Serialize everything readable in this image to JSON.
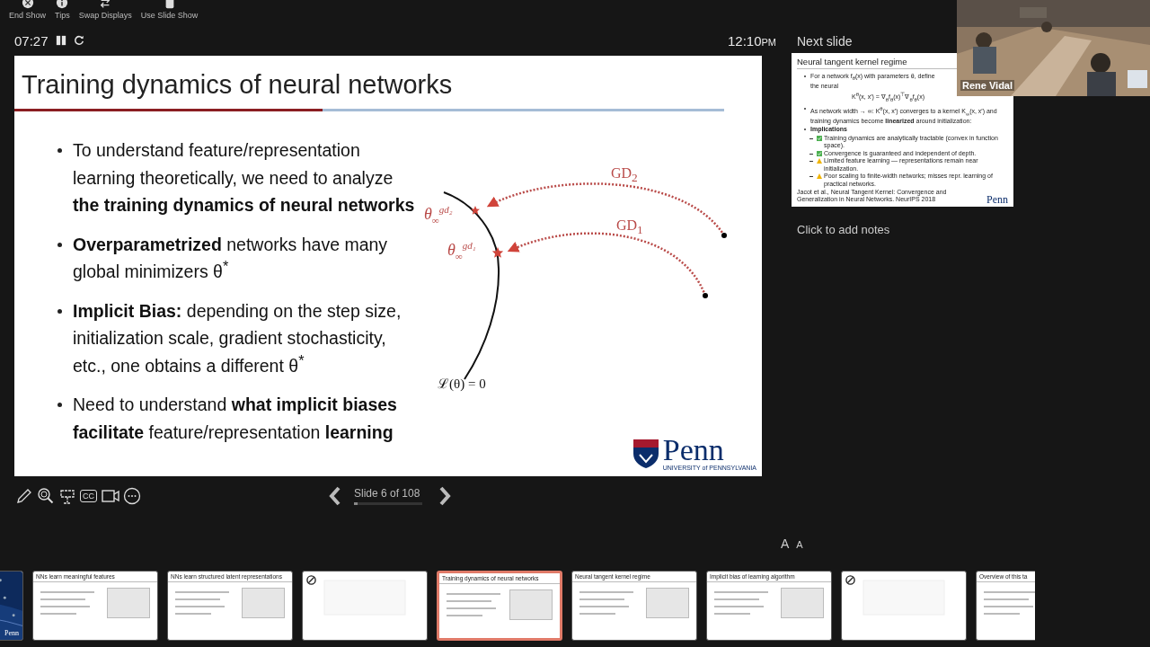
{
  "top_toolbar": [
    {
      "kind": "end",
      "label": "End Show"
    },
    {
      "kind": "tips",
      "label": "Tips"
    },
    {
      "kind": "swap",
      "label": "Swap Displays"
    },
    {
      "kind": "slideshow",
      "label": "Use Slide Show"
    }
  ],
  "timer": {
    "elapsed": "07:27",
    "clock": "12:10",
    "ampm": "PM"
  },
  "slide": {
    "title": "Training dynamics of neural networks",
    "bullets": [
      "To understand feature/representation learning theoretically, we need to analyze **the training dynamics of neural networks**",
      "**Overparametrized** networks have many global minimizers θ$^{*}$",
      "**Implicit Bias:** depending on the step size, initialization scale, gradient stochasticity, etc., one obtains a different θ$^{*}$",
      "Need to understand **what implicit biases facilitate** feature/representation **learning**"
    ],
    "diagram": {
      "gd2_label": "GD$_{2}$",
      "gd1_label": "GD$_{1}$",
      "theta2_label": "θ$_{∞}$$^{gd₂}$",
      "theta1_label": "θ$_{∞}$$^{gd₁}$",
      "curve_label": "ℒ(θ) = 0"
    },
    "logo": {
      "name": "Penn",
      "subtitle": "UNIVERSITY of PENNSYLVANIA"
    }
  },
  "bottom_toolbar": [
    {
      "kind": "pen"
    },
    {
      "kind": "zoom"
    },
    {
      "kind": "pointer"
    },
    {
      "kind": "captions",
      "label": "CC"
    },
    {
      "kind": "camera"
    },
    {
      "kind": "more"
    }
  ],
  "navigation": {
    "position": "Slide 6 of 108",
    "level": 0.056
  },
  "next_slide": {
    "heading": "Next slide",
    "title": "Neural tangent kernel regime",
    "bullets": [
      {
        "kind": "text",
        "text": "For a network f$_{θ}$(x) with parameters θ, define the neural"
      },
      {
        "kind": "formula",
        "text": "K$^{θ}$(x, x′) = ∇$_{θ}$f$_{θ}$(x)$^{⊤}$∇$_{θ}$f$_{θ}$(x)"
      },
      {
        "kind": "text",
        "text": "As network width → ∞: K$^{θ}$(x, x′) converges to a kernel K$_{∞}$(x, x′) and training dynamics become **linearized** around initialization:"
      },
      {
        "kind": "heading",
        "text": "Implications"
      },
      {
        "kind": "check",
        "text": "Training dynamics are analytically tractable (convex in function space)."
      },
      {
        "kind": "check",
        "text": "Convergence is guaranteed and independent of depth."
      },
      {
        "kind": "warning",
        "text": "Limited feature learning — representations remain near initialization."
      },
      {
        "kind": "warning",
        "text": "Poor scaling to finite-width networks; misses repr. learning of practical networks."
      }
    ],
    "footnote": "Jacot et al., Neural Tangent Kernel: Convergence and Generalization in Neural Networks. NeurIPS 2018",
    "logo": "Penn"
  },
  "webcam": {
    "name": "Rene Vidal"
  },
  "notes": {
    "placeholder": "Click to add notes"
  },
  "font_buttons": [
    "A",
    "A"
  ],
  "thumbnails": [
    {
      "kind": "title",
      "logo": "Penn",
      "selected": false
    },
    {
      "kind": "content",
      "title": "NNs learn meaningful features",
      "selected": false
    },
    {
      "kind": "content",
      "title": "NNs learn structured latent representations",
      "selected": false
    },
    {
      "kind": "hidden",
      "selected": false
    },
    {
      "kind": "content",
      "title": "Training dynamics of neural networks",
      "selected": true
    },
    {
      "kind": "content",
      "title": "Neural tangent kernel regime",
      "selected": false
    },
    {
      "kind": "content",
      "title": "Implicit bias of learning algorithm",
      "selected": false
    },
    {
      "kind": "hidden",
      "selected": false
    },
    {
      "kind": "content",
      "title": "Overview of this ta",
      "selected": false
    }
  ]
}
